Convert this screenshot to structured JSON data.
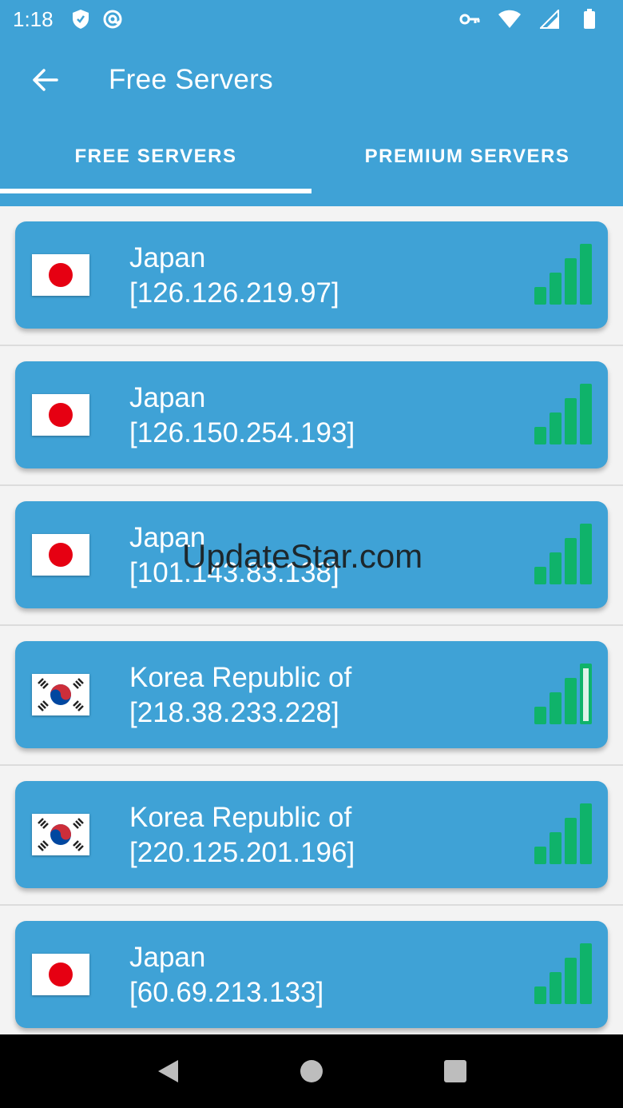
{
  "status_bar": {
    "time": "1:18",
    "icons": [
      "shield-icon",
      "at-sign-icon",
      "vpn-key-icon",
      "wifi-icon",
      "cell-signal-icon",
      "battery-icon"
    ]
  },
  "app_bar": {
    "back_icon": "arrow-left-icon",
    "title": "Free Servers"
  },
  "tabs": [
    {
      "label": "FREE SERVERS",
      "active": true
    },
    {
      "label": "PREMIUM SERVERS",
      "active": false
    }
  ],
  "servers": [
    {
      "country": "Japan",
      "ip": "[126.126.219.97]",
      "flag": "japan-flag",
      "signal_bars": 4
    },
    {
      "country": "Japan",
      "ip": "[126.150.254.193]",
      "flag": "japan-flag",
      "signal_bars": 4
    },
    {
      "country": "Japan",
      "ip": "[101.143.83.138]",
      "flag": "japan-flag",
      "signal_bars": 4
    },
    {
      "country": "Korea Republic of",
      "ip": "[218.38.233.228]",
      "flag": "korea-flag",
      "signal_bars": 3
    },
    {
      "country": "Korea Republic of",
      "ip": "[220.125.201.196]",
      "flag": "korea-flag",
      "signal_bars": 4
    },
    {
      "country": "Japan",
      "ip": "[60.69.213.133]",
      "flag": "japan-flag",
      "signal_bars": 4
    }
  ],
  "watermark": "UpdateStar.com",
  "colors": {
    "primary": "#3fa2d6",
    "signal_on": "#0fb36a",
    "signal_off": "#dff3e8",
    "japan_red": "#e60012",
    "korea_red": "#cd2e3a",
    "korea_blue": "#0047a0"
  },
  "nav_bar": {
    "icons": [
      "back-triangle-icon",
      "home-circle-icon",
      "recents-square-icon"
    ]
  }
}
